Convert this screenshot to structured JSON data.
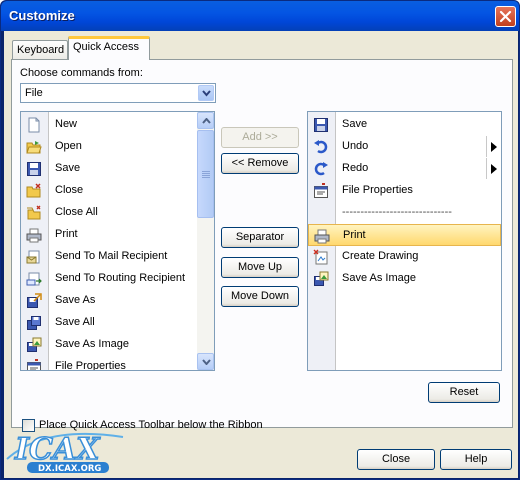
{
  "window": {
    "title": "Customize"
  },
  "tabs": [
    {
      "label": "Keyboard"
    },
    {
      "label": "Quick Access"
    }
  ],
  "choose": {
    "label": "Choose commands from:",
    "value": "File"
  },
  "left_list": {
    "items": [
      {
        "label": "New",
        "icon": "new-document-icon"
      },
      {
        "label": "Open",
        "icon": "open-folder-icon"
      },
      {
        "label": "Save",
        "icon": "save-disk-icon"
      },
      {
        "label": "Close",
        "icon": "close-folder-icon"
      },
      {
        "label": "Close All",
        "icon": "close-all-icon"
      },
      {
        "label": "Print",
        "icon": "print-icon"
      },
      {
        "label": "Send To Mail Recipient",
        "icon": "mail-icon"
      },
      {
        "label": "Send To Routing Recipient",
        "icon": "routing-icon"
      },
      {
        "label": "Save As",
        "icon": "save-as-icon"
      },
      {
        "label": "Save All",
        "icon": "save-all-icon"
      },
      {
        "label": "Save As Image",
        "icon": "save-as-image-icon"
      },
      {
        "label": "File Properties",
        "icon": "file-properties-icon"
      }
    ]
  },
  "middle_buttons": {
    "add": "Add >>",
    "remove": "<< Remove",
    "separator": "Separator",
    "move_up": "Move Up",
    "move_down": "Move Down"
  },
  "right_list": {
    "items": [
      {
        "label": "Save",
        "icon": "save-disk-icon"
      },
      {
        "label": "Undo",
        "icon": "undo-icon",
        "submenu": true
      },
      {
        "label": "Redo",
        "icon": "redo-icon",
        "submenu": true
      },
      {
        "label": "File Properties",
        "icon": "file-properties-icon"
      },
      {
        "label": "------------------------------",
        "separator": true
      },
      {
        "label": "Print",
        "icon": "print-icon",
        "selected": true
      },
      {
        "label": "Create Drawing",
        "icon": "create-drawing-icon"
      },
      {
        "label": "Save As Image",
        "icon": "save-as-image-icon"
      }
    ]
  },
  "reset_label": "Reset",
  "checkbox_label": "Place Quick Access Toolbar below the Ribbon",
  "checkbox_checked": false,
  "footer": {
    "close_label": "Close",
    "help_label": "Help"
  },
  "watermark": {
    "logo_text": "ICAX",
    "url_text": "DX.ICAX.ORG"
  },
  "colors": {
    "titlebar": "#0455e3",
    "dialog_bg": "#ece9d8",
    "selection": "#ffd86e",
    "active_tab_accent": "#ffc83c"
  }
}
